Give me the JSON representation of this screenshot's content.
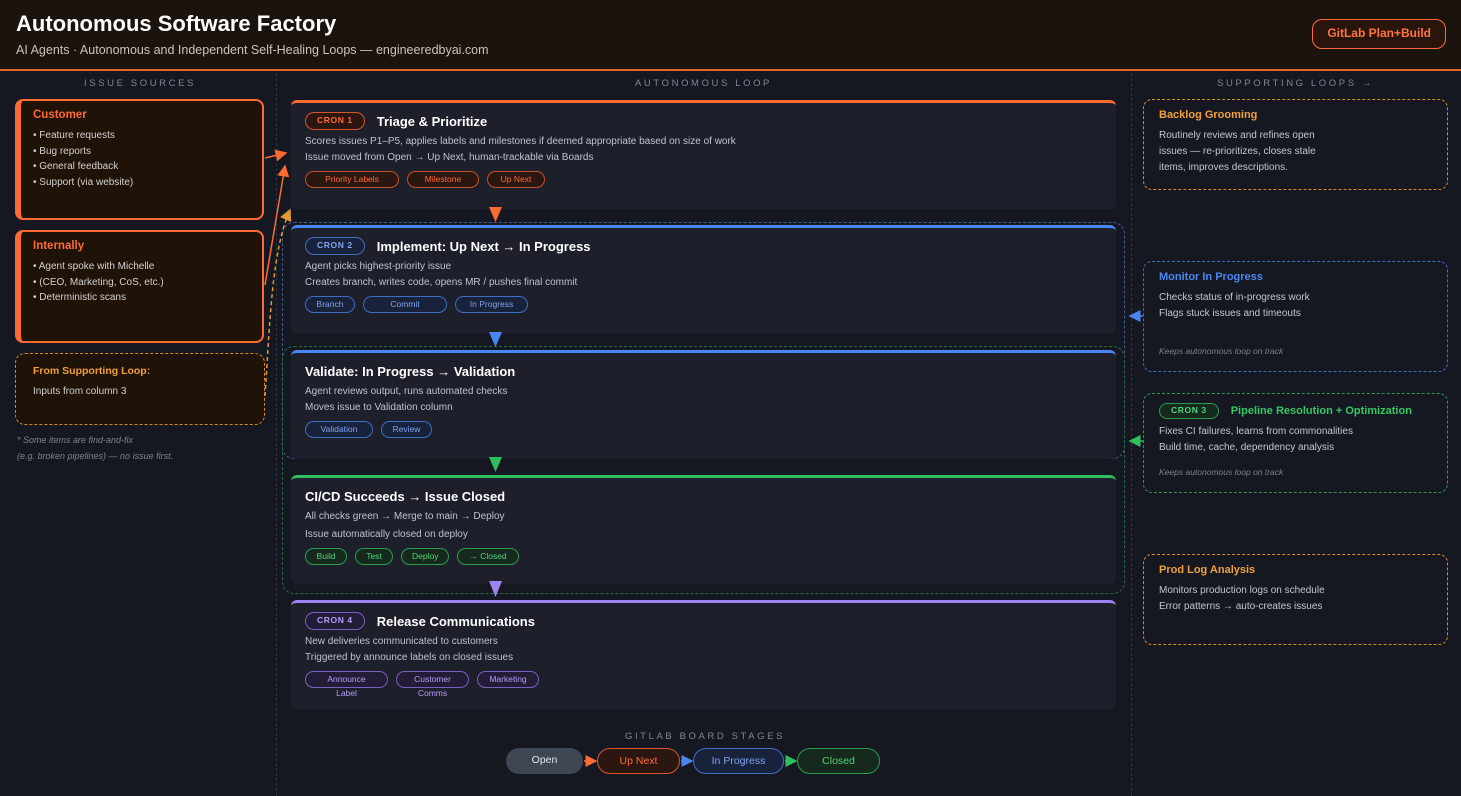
{
  "header": {
    "title": "Autonomous Software Factory",
    "subtitle": "AI Agents · Autonomous and Independent Self-Healing Loops — engineeredbyai.com",
    "button": "GitLab Plan+Build"
  },
  "columns": {
    "left": "ISSUE SOURCES",
    "center": "AUTONOMOUS LOOP",
    "right": "SUPPORTING LOOPS →"
  },
  "sources": {
    "customer": {
      "title": "Customer",
      "items": [
        "• Feature requests",
        "• Bug reports",
        "• General feedback",
        "• Support (via website)"
      ]
    },
    "internal": {
      "title": "Internally",
      "items": [
        "• Agent spoke with Michelle",
        "• (CEO, Marketing, CoS, etc.)",
        "• Deterministic scans"
      ]
    },
    "supporting": {
      "title": "From Supporting Loop:",
      "text": "Inputs from column 3"
    },
    "footnote": [
      "* Some items are find-and-fix",
      "(e.g. broken pipelines) — no issue first."
    ]
  },
  "loop": {
    "triage": {
      "badge": "CRON 1",
      "title": "Triage & Prioritize",
      "lines": [
        "Scores issues P1–P5, applies labels and milestones if deemed appropriate based on size of work",
        "Issue moved from Open → Up Next, human-trackable via Boards"
      ],
      "tags": [
        "Priority Labels",
        "Milestone",
        "Up Next"
      ]
    },
    "implement": {
      "badge": "CRON 2",
      "title": "Implement: Up Next → In Progress",
      "lines": [
        "Agent picks highest-priority issue",
        "Creates branch, writes code, opens MR / pushes final commit"
      ],
      "tags": [
        "Branch",
        "Commit",
        "In Progress"
      ]
    },
    "validate": {
      "title": "Validate: In Progress → Validation",
      "lines": [
        "Agent reviews output, runs automated checks",
        "Moves issue to Validation column"
      ],
      "tags": [
        "Validation",
        "Review"
      ]
    },
    "cicd": {
      "title": "CI/CD Succeeds → Issue Closed",
      "lines": [
        "All checks green → Merge to main → Deploy",
        "Issue automatically closed on deploy"
      ],
      "tags": [
        "Build",
        "Test",
        "Deploy",
        "→ Closed"
      ]
    },
    "release": {
      "badge": "CRON 4",
      "title": "Release Communications",
      "lines": [
        "New deliveries communicated to customers",
        "Triggered by announce labels on closed issues"
      ],
      "tags": [
        "Announce Label",
        "Customer Comms",
        "Marketing"
      ]
    }
  },
  "supporting": {
    "backlog": {
      "title": "Backlog Grooming",
      "lines": [
        "Routinely reviews and refines open",
        "issues — re-prioritizes, closes stale",
        "items, improves descriptions."
      ]
    },
    "monitor": {
      "title": "Monitor In Progress",
      "lines": [
        "Checks status of in-progress work",
        "Flags stuck issues and timeouts"
      ],
      "note": "Keeps autonomous loop on track"
    },
    "pipeline": {
      "badge": "CRON 3",
      "title": "Pipeline Resolution + Optimization",
      "lines": [
        "Fixes CI failures, learns from commonalities",
        "Build time, cache, dependency analysis"
      ],
      "note": "Keeps autonomous loop on track"
    },
    "prodlog": {
      "title": "Prod Log Analysis",
      "lines": [
        "Monitors production logs on schedule",
        "Error patterns → auto-creates issues"
      ]
    }
  },
  "stages": {
    "title": "GITLAB BOARD STAGES",
    "items": [
      "Open",
      "Up Next",
      "In Progress",
      "Closed"
    ]
  },
  "colors": {
    "orange": "#ff6a33",
    "blue": "#4a86f0",
    "green": "#2fbf5e",
    "purple": "#a083f2",
    "amber": "#e39a35"
  }
}
